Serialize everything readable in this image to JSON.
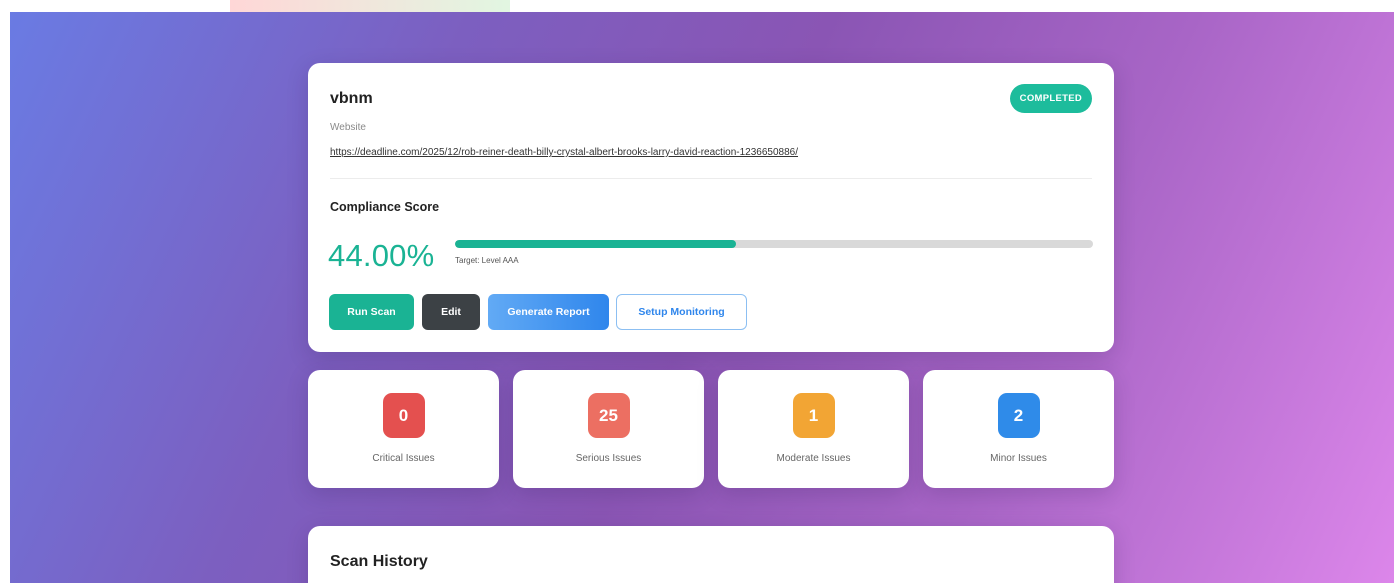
{
  "project": {
    "name": "vbnm",
    "type": "Website",
    "url": "https://deadline.com/2025/12/rob-reiner-death-billy-crystal-albert-brooks-larry-david-reaction-1236650886/",
    "status": "COMPLETED"
  },
  "compliance": {
    "title": "Compliance Score",
    "score_text": "44.00%",
    "score_fraction": 0.44,
    "target": "Target: Level AAA",
    "bar_color": "#1ab394"
  },
  "actions": {
    "run_scan": "Run Scan",
    "edit": "Edit",
    "generate_report": "Generate Report",
    "setup_monitoring": "Setup Monitoring"
  },
  "issues": [
    {
      "count": "0",
      "label": "Critical Issues",
      "color": "#e4504f"
    },
    {
      "count": "25",
      "label": "Serious Issues",
      "color": "#ec6f62"
    },
    {
      "count": "1",
      "label": "Moderate Issues",
      "color": "#f2a534"
    },
    {
      "count": "2",
      "label": "Minor Issues",
      "color": "#2f8be9"
    }
  ],
  "history": {
    "title": "Scan History"
  }
}
